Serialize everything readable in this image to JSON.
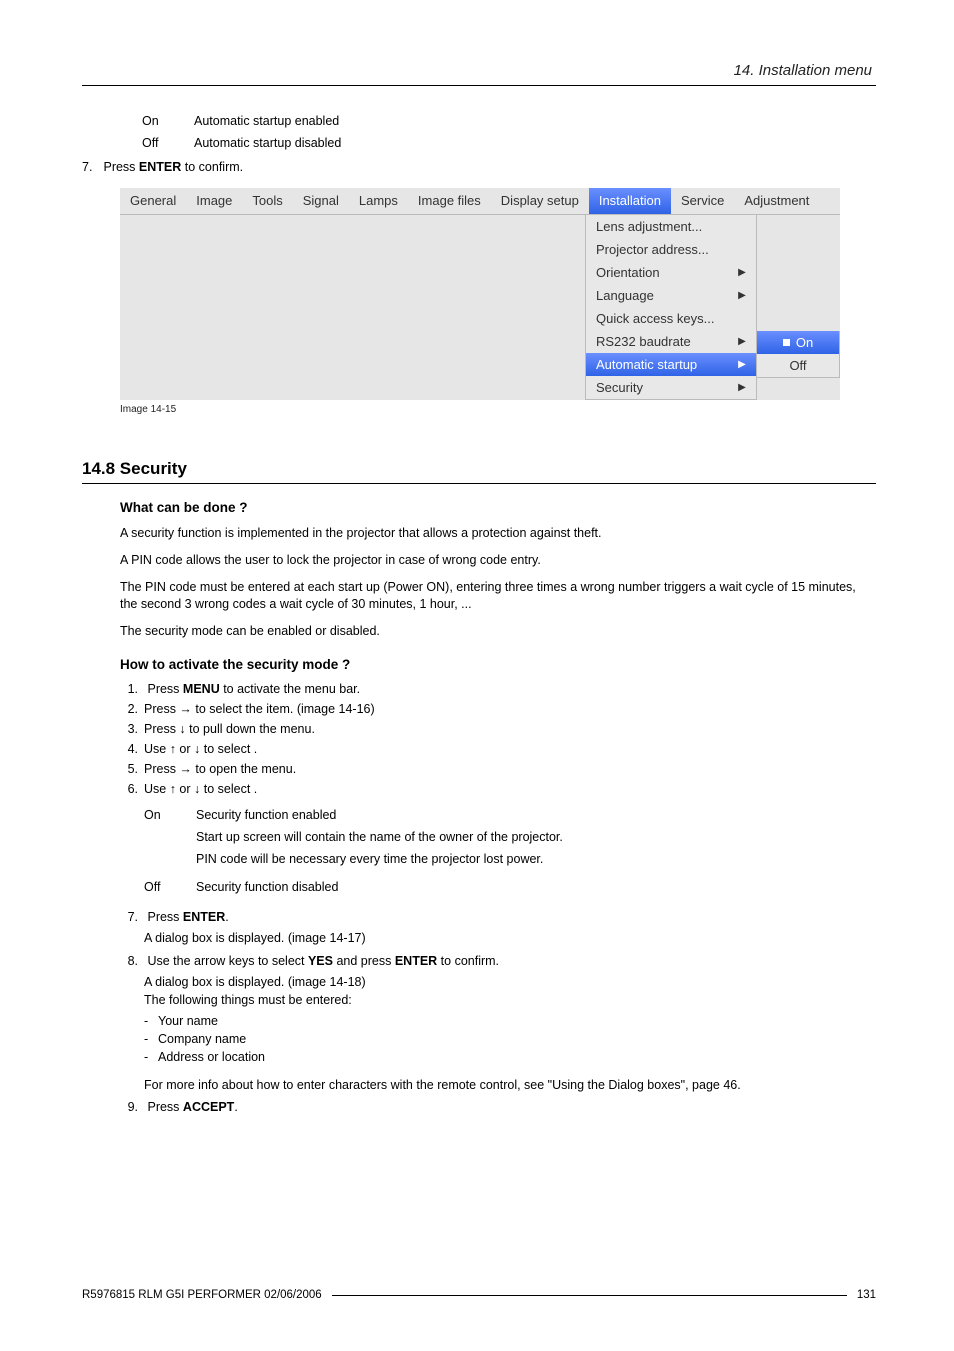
{
  "header": {
    "title": "14.  Installation menu"
  },
  "intro_defs": [
    {
      "key": "On",
      "text": "Automatic startup enabled"
    },
    {
      "key": "Off",
      "text": "Automatic startup disabled"
    }
  ],
  "step7": {
    "num": "7.",
    "pre": "Press ",
    "bold": "ENTER",
    "post": " to confirm."
  },
  "menubar": {
    "tabs": [
      "General",
      "Image",
      "Tools",
      "Signal",
      "Lamps",
      "Image files",
      "Display setup",
      "Installation",
      "Service",
      "Adjustment"
    ],
    "selected_index": 7,
    "dropdown": [
      {
        "label": "Lens adjustment...",
        "arrow": false
      },
      {
        "label": "Projector address...",
        "arrow": false
      },
      {
        "label": "Orientation",
        "arrow": true
      },
      {
        "label": "Language",
        "arrow": true
      },
      {
        "label": "Quick access keys...",
        "arrow": false
      },
      {
        "label": "RS232 baudrate",
        "arrow": true
      },
      {
        "label": "Automatic startup",
        "arrow": true,
        "selected": true
      },
      {
        "label": "Security",
        "arrow": true
      }
    ],
    "submenu": [
      {
        "label": "On",
        "selected": true
      },
      {
        "label": "Off",
        "selected": false
      }
    ]
  },
  "image_caption": "Image 14-15",
  "section": {
    "num_title": "14.8  Security"
  },
  "what_heading": "What can be done ?",
  "what_paras": [
    "A security function is implemented in the projector that allows a protection against theft.",
    "A PIN code allows the user to lock the projector in case of wrong code entry.",
    "The PIN code must be entered at each start up (Power ON), entering three times a wrong number triggers a wait cycle of 15 minutes, the second 3 wrong codes a wait cycle of 30 minutes, 1 hour, ...",
    "The security mode can be enabled or disabled."
  ],
  "how_heading": "How to activate the security mode ?",
  "steps": {
    "s1": {
      "num": "1.",
      "pre": "Press ",
      "bold": "MENU",
      "post": " to activate the menu bar."
    },
    "s2": {
      "num": "2.",
      "text": "Press → to select the                     item.  (image 14-16)"
    },
    "s3": {
      "num": "3.",
      "text": "Press ↓ to pull down the menu."
    },
    "s4": {
      "num": "4.",
      "text": "Use ↑ or ↓ to select              ."
    },
    "s5": {
      "num": "5.",
      "text": "Press → to open the menu."
    },
    "s6": {
      "num": "6.",
      "text": "Use ↑ or ↓ to select       ."
    },
    "s6_defs": {
      "on_key": "On",
      "on_lines": [
        "Security function enabled",
        "Start up screen will contain the name of the owner of the projector.",
        "PIN code will be necessary every time the projector lost power."
      ],
      "off_key": "Off",
      "off_text": "Security function disabled"
    },
    "s7": {
      "num": "7.",
      "pre": "Press ",
      "bold": "ENTER",
      "post": "."
    },
    "s7_sub": "A dialog box is displayed.  (image 14-17)",
    "s8": {
      "num": "8.",
      "pre": "Use the arrow keys to select ",
      "bold": "YES",
      "mid": " and press ",
      "bold2": "ENTER",
      "post": " to confirm."
    },
    "s8_sub1": "A dialog box is displayed.  (image 14-18)",
    "s8_sub2": "The following things must be entered:",
    "s8_items": [
      "Your name",
      "Company name",
      "Address or location"
    ],
    "s8_note": "For more info about how to enter characters with the remote control, see \"Using the Dialog boxes\", page 46.",
    "s9": {
      "num": "9.",
      "pre": "Press ",
      "bold": "ACCEPT",
      "post": "."
    }
  },
  "footer": {
    "left": "R5976815  RLM G5I PERFORMER  02/06/2006",
    "page": "131"
  }
}
